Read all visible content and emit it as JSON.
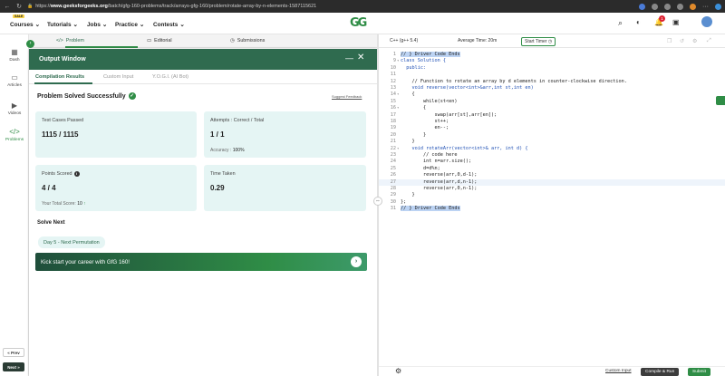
{
  "browser": {
    "url_prefix": "https://",
    "url_domain": "www.geeksforgeeks.org",
    "url_path": "/batch/gfg-160-problems/track/arrays-gfg-160/problem/rotate-array-by-n-elements-1587115621",
    "notification_count": "1"
  },
  "site": {
    "sale_badge": "SALE",
    "menus": [
      "Courses",
      "Tutorials",
      "Jobs",
      "Practice",
      "Contests"
    ],
    "logo": "GG"
  },
  "sidebar": {
    "items": [
      {
        "label": "Dash",
        "icon": "dashboard-icon"
      },
      {
        "label": "Articles",
        "icon": "book-icon"
      },
      {
        "label": "Videos",
        "icon": "video-icon"
      },
      {
        "label": "Problems",
        "icon": "code-icon"
      }
    ],
    "prev": "« Prev",
    "next": "Next »"
  },
  "problem_tabs": [
    "Problem",
    "Editorial",
    "Submissions"
  ],
  "output": {
    "title": "Output Window",
    "tabs": [
      "Compilation Results",
      "Custom Input",
      "Y.O.G.I. (AI Bot)"
    ],
    "status": "Problem Solved Successfully",
    "suggest": "Suggest Feedback",
    "cards": {
      "test_cases_label": "Test Cases Passed",
      "test_cases_value": "1115 / 1115",
      "attempts_label": "Attempts : Correct / Total",
      "attempts_value": "1 / 1",
      "accuracy_label": "Accuracy :",
      "accuracy_value": "100%",
      "points_label": "Points Scored",
      "points_value": "4 / 4",
      "total_score_label": "Your Total Score:",
      "total_score_value": "10",
      "time_label": "Time Taken",
      "time_value": "0.29"
    },
    "solve_next": "Solve Next",
    "next_problem": "Day 5 - Next Permutation",
    "banner": "Kick start your career with GfG 160!"
  },
  "editor": {
    "language": "C++ (g++ 5.4)",
    "avg_time": "Average Time: 20m",
    "timer": "Start Timer",
    "custom_input": "Custom Input",
    "compile": "Compile & Run",
    "submit": "Submit",
    "lines": [
      {
        "n": "1",
        "t": "// } Driver Code Ends"
      },
      {
        "n": "9",
        "t": "class Solution {"
      },
      {
        "n": "10",
        "t": "  public:"
      },
      {
        "n": "11",
        "t": ""
      },
      {
        "n": "12",
        "t": "    // Function to rotate an array by d elements in counter-clockwise direction."
      },
      {
        "n": "13",
        "t": "    void reverse(vector<int>&arr,int st,int en)"
      },
      {
        "n": "14",
        "t": "    {"
      },
      {
        "n": "15",
        "t": "        while(st<en)"
      },
      {
        "n": "16",
        "t": "        {"
      },
      {
        "n": "17",
        "t": "            swap(arr[st],arr[en]);"
      },
      {
        "n": "18",
        "t": "            st++;"
      },
      {
        "n": "19",
        "t": "            en--;"
      },
      {
        "n": "20",
        "t": "        }"
      },
      {
        "n": "21",
        "t": "    }"
      },
      {
        "n": "22",
        "t": "    void rotateArr(vector<int>& arr, int d) {"
      },
      {
        "n": "23",
        "t": "        // code here"
      },
      {
        "n": "24",
        "t": "        int n=arr.size();"
      },
      {
        "n": "25",
        "t": "        d=d%n;"
      },
      {
        "n": "26",
        "t": "        reverse(arr,0,d-1);"
      },
      {
        "n": "27",
        "t": "        reverse(arr,d,n-1);"
      },
      {
        "n": "28",
        "t": "        reverse(arr,0,n-1);"
      },
      {
        "n": "29",
        "t": "    }"
      },
      {
        "n": "30",
        "t": "};"
      },
      {
        "n": "31",
        "t": "// } Driver Code Ends"
      }
    ]
  },
  "colors": {
    "brand": "#2f8d46",
    "header_green": "#2f6b4f",
    "card_bg": "#e5f5f4"
  }
}
